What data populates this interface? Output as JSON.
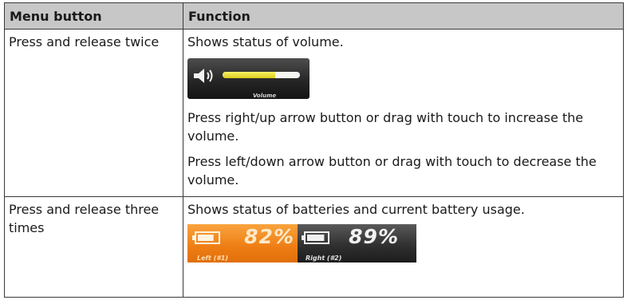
{
  "table": {
    "headers": [
      "Menu button",
      "Function"
    ],
    "rows": [
      {
        "action": "Press and release twice",
        "description": "Shows status of volume.",
        "volume_widget": {
          "caption": "Volume",
          "level": 0.68,
          "icon": "speaker-icon",
          "bar_color": "#e6dc2a"
        },
        "notes": [
          "Press right/up arrow button or drag with touch to increase the volume.",
          "Press left/down arrow button or drag with touch to decrease the volume."
        ]
      },
      {
        "action": "Press and release three times",
        "description": "Shows status of batteries and current battery usage.",
        "batteries": [
          {
            "caption": "Left (#1)",
            "percent": "82%",
            "level": 0.82,
            "icon": "battery-icon",
            "color": "#f28a20"
          },
          {
            "caption": "Right (#2)",
            "percent": "89%",
            "level": 0.89,
            "icon": "battery-icon",
            "color": "#2e2e2e"
          }
        ]
      }
    ]
  }
}
